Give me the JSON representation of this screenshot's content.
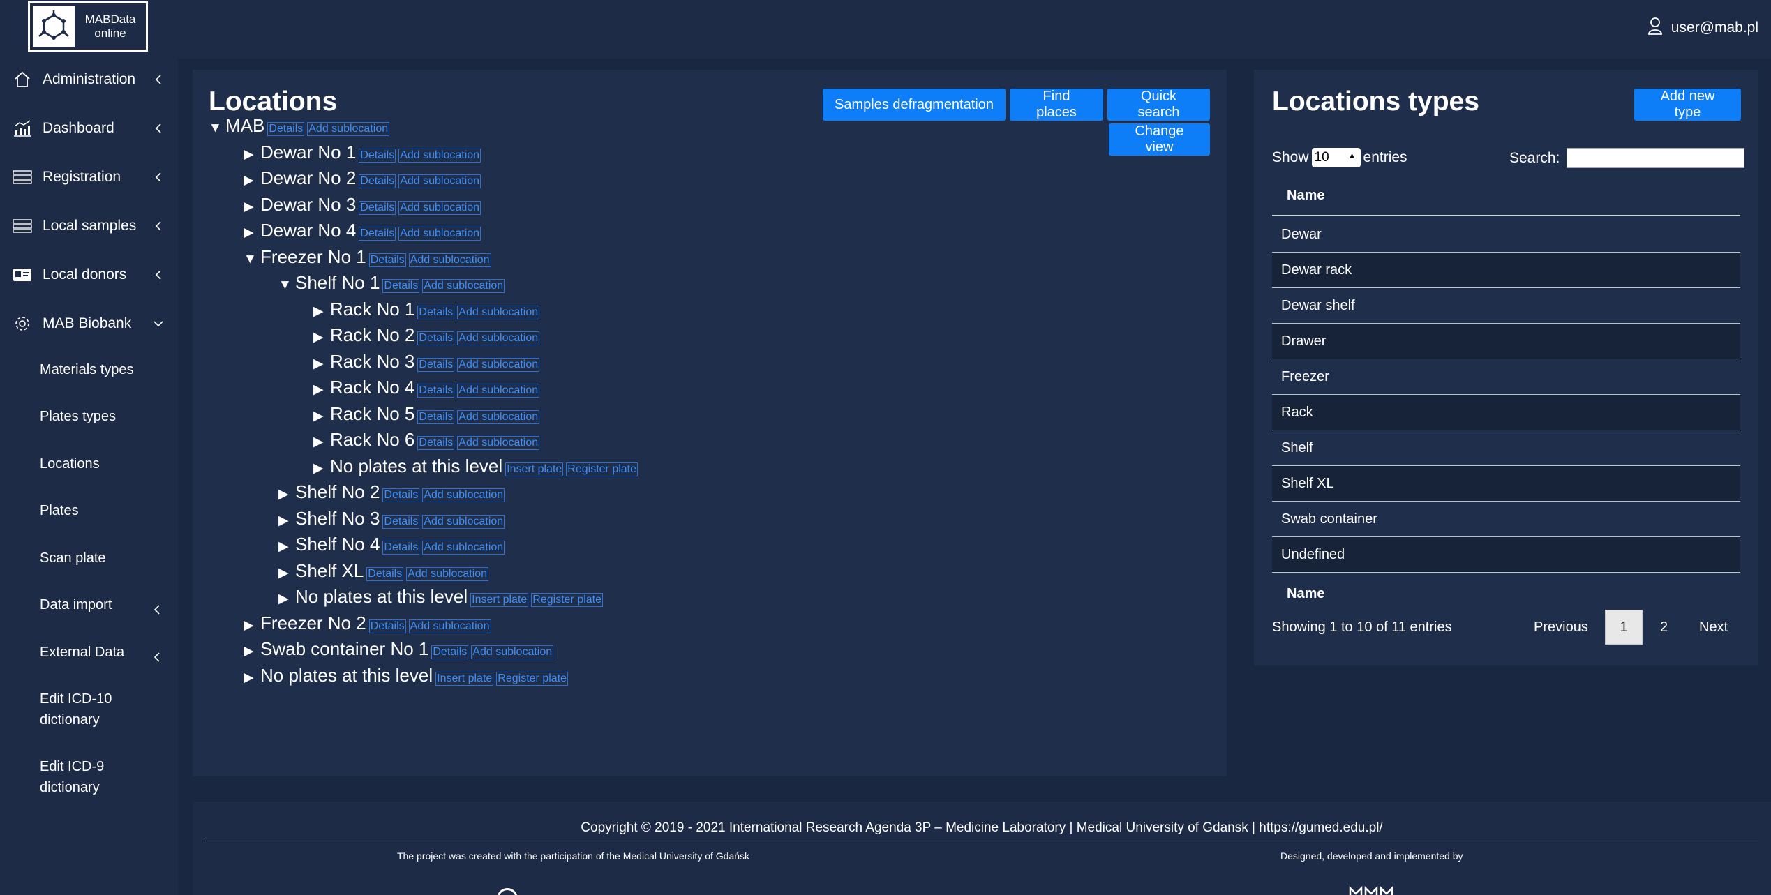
{
  "app": {
    "logo_line1": "MABData",
    "logo_line2": "online",
    "user": "user@mab.pl"
  },
  "sidebar": {
    "items": [
      {
        "label": "Administration",
        "icon": "home-icon"
      },
      {
        "label": "Dashboard",
        "icon": "chart-icon"
      },
      {
        "label": "Registration",
        "icon": "list-icon"
      },
      {
        "label": "Local samples",
        "icon": "list-icon"
      },
      {
        "label": "Local donors",
        "icon": "id-card-icon"
      },
      {
        "label": "MAB Biobank",
        "icon": "gear-icon"
      }
    ],
    "subitems": [
      "Materials types",
      "Plates types",
      "Locations",
      "Plates",
      "Scan plate",
      "Data import",
      "External Data",
      "Edit ICD-10 dictionary",
      "Edit ICD-9 dictionary"
    ]
  },
  "locations": {
    "title": "Locations",
    "buttons": {
      "defrag": "Samples defragmentation",
      "find": "Find places",
      "quick": "Quick search",
      "change_view": "Change view"
    },
    "links": {
      "details": "Details",
      "add_sub": "Add sublocation",
      "insert_plate": "Insert plate",
      "register_plate": "Register plate"
    },
    "tree": [
      {
        "label": "MAB",
        "level": 0,
        "open": true,
        "kind": "loc"
      },
      {
        "label": "Dewar No 1",
        "level": 1,
        "open": false,
        "kind": "loc"
      },
      {
        "label": "Dewar No 2",
        "level": 1,
        "open": false,
        "kind": "loc"
      },
      {
        "label": "Dewar No 3",
        "level": 1,
        "open": false,
        "kind": "loc"
      },
      {
        "label": "Dewar No 4",
        "level": 1,
        "open": false,
        "kind": "loc"
      },
      {
        "label": "Freezer No 1",
        "level": 1,
        "open": true,
        "kind": "loc"
      },
      {
        "label": "Shelf No 1",
        "level": 2,
        "open": true,
        "kind": "loc"
      },
      {
        "label": "Rack No 1",
        "level": 3,
        "open": false,
        "kind": "loc"
      },
      {
        "label": "Rack No 2",
        "level": 3,
        "open": false,
        "kind": "loc"
      },
      {
        "label": "Rack No 3",
        "level": 3,
        "open": false,
        "kind": "loc"
      },
      {
        "label": "Rack No 4",
        "level": 3,
        "open": false,
        "kind": "loc"
      },
      {
        "label": "Rack No 5",
        "level": 3,
        "open": false,
        "kind": "loc"
      },
      {
        "label": "Rack No 6",
        "level": 3,
        "open": false,
        "kind": "loc"
      },
      {
        "label": "No plates at this level",
        "level": 3,
        "open": false,
        "kind": "plate"
      },
      {
        "label": "Shelf No 2",
        "level": 2,
        "open": false,
        "kind": "loc"
      },
      {
        "label": "Shelf No 3",
        "level": 2,
        "open": false,
        "kind": "loc"
      },
      {
        "label": "Shelf No 4",
        "level": 2,
        "open": false,
        "kind": "loc"
      },
      {
        "label": "Shelf XL",
        "level": 2,
        "open": false,
        "kind": "loc"
      },
      {
        "label": "No plates at this level",
        "level": 2,
        "open": false,
        "kind": "plate"
      },
      {
        "label": "Freezer No 2",
        "level": 1,
        "open": false,
        "kind": "loc"
      },
      {
        "label": "Swab container No 1",
        "level": 1,
        "open": false,
        "kind": "loc"
      },
      {
        "label": "No plates at this level",
        "level": 1,
        "open": false,
        "kind": "plate"
      }
    ]
  },
  "types": {
    "title": "Locations types",
    "add_button": "Add new type",
    "show_label": "Show",
    "entries_value": "10",
    "entries_label": "entries",
    "search_label": "Search:",
    "column": "Name",
    "rows": [
      "Dewar",
      "Dewar rack",
      "Dewar shelf",
      "Drawer",
      "Freezer",
      "Rack",
      "Shelf",
      "Shelf XL",
      "Swab container",
      "Undefined"
    ],
    "info": "Showing 1 to 10 of 11 entries",
    "pager": {
      "previous": "Previous",
      "page1": "1",
      "page2": "2",
      "next": "Next"
    }
  },
  "footer": {
    "copyright": "Copyright © 2019 - 2021 International Research Agenda 3P – Medicine Laboratory | Medical University of Gdansk | https://gumed.edu.pl/",
    "left_note": "The project was created with the participation of the Medical University of Gdańsk",
    "right_note": "Designed, developed and implemented by"
  }
}
